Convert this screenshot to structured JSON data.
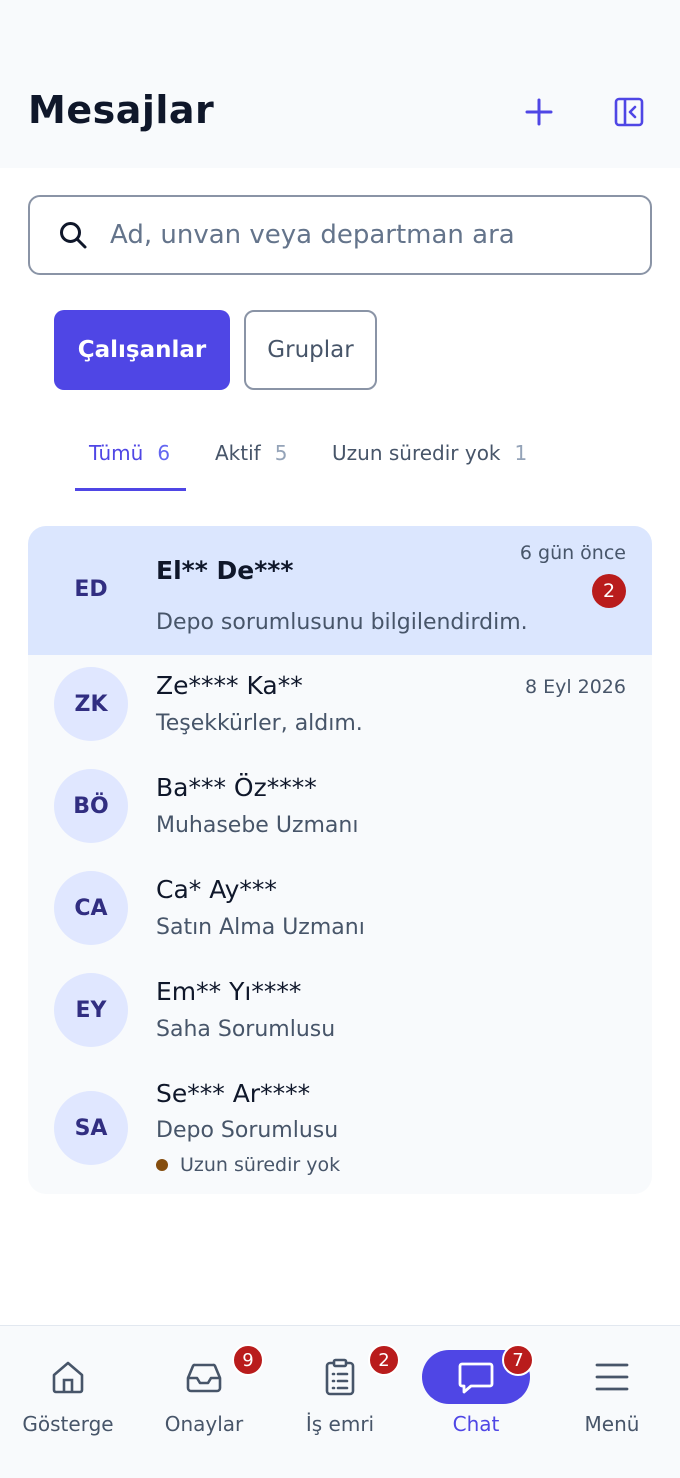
{
  "header": {
    "title": "Mesajlar",
    "add_icon": "plus-icon",
    "collapse_icon": "sidebar-collapse-icon"
  },
  "search": {
    "placeholder": "Ad, unvan veya departman ara",
    "value": ""
  },
  "segments": [
    {
      "label": "Çalışanlar",
      "active": true
    },
    {
      "label": "Gruplar",
      "active": false
    }
  ],
  "filters": [
    {
      "label": "Tümü",
      "count": "6",
      "active": true
    },
    {
      "label": "Aktif",
      "count": "5",
      "active": false
    },
    {
      "label": "Uzun süredir yok",
      "count": "1",
      "active": false
    }
  ],
  "contacts": [
    {
      "initials": "ED",
      "name": "El** De***",
      "subtitle": "Depo sorumlusunu bilgilendirdim.",
      "time": "6 gün önce",
      "unread": "2"
    },
    {
      "initials": "ZK",
      "name": "Ze**** Ka**",
      "subtitle": "Teşekkürler, aldım.",
      "time": "8 Eyl 2026"
    },
    {
      "initials": "BÖ",
      "name": "Ba*** Öz****",
      "subtitle": "Muhasebe Uzmanı"
    },
    {
      "initials": "CA",
      "name": "Ca* Ay***",
      "subtitle": "Satın Alma Uzmanı"
    },
    {
      "initials": "EY",
      "name": "Em** Yı****",
      "subtitle": "Saha Sorumlusu"
    },
    {
      "initials": "SA",
      "name": "Se*** Ar****",
      "subtitle": "Depo Sorumlusu",
      "status": "Uzun süredir yok"
    }
  ],
  "bottom_nav": [
    {
      "label": "Gösterge",
      "icon": "home-icon"
    },
    {
      "label": "Onaylar",
      "icon": "inbox-icon",
      "badge": "9"
    },
    {
      "label": "İş emri",
      "icon": "clipboard-icon",
      "badge": "2"
    },
    {
      "label": "Chat",
      "icon": "chat-icon",
      "badge": "7",
      "active": true
    },
    {
      "label": "Menü",
      "icon": "menu-icon"
    }
  ],
  "colors": {
    "accent": "#4f46e5",
    "badge": "#b91c1c",
    "highlight": "#dbe6fe",
    "away_dot": "#854d0e"
  }
}
